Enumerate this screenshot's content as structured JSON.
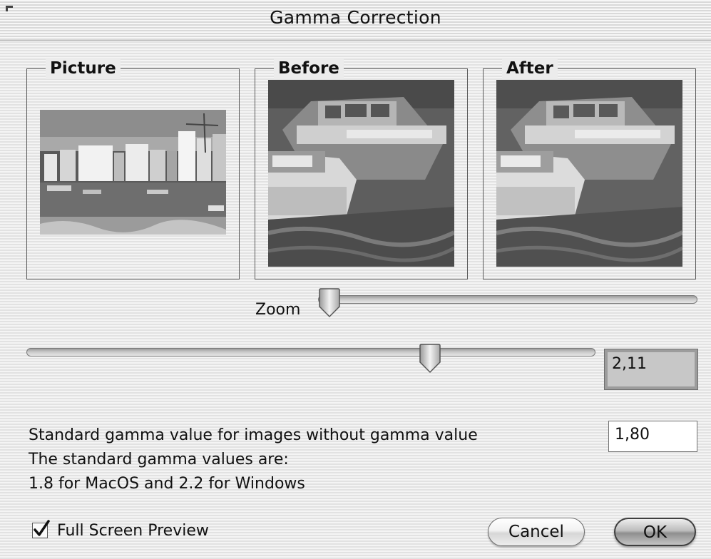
{
  "window": {
    "title": "Gamma Correction"
  },
  "panels": {
    "picture": {
      "label": "Picture"
    },
    "before": {
      "label": "Before"
    },
    "after": {
      "label": "After"
    }
  },
  "zoom": {
    "label": "Zoom",
    "position": 0.0
  },
  "gamma_slider": {
    "position": 0.66,
    "value": "2,11"
  },
  "standard_gamma": {
    "line1": "Standard gamma value for images without gamma value",
    "line2": "The standard gamma values are:",
    "line3": "1.8 for MacOS and 2.2 for Windows",
    "value": "1,80"
  },
  "full_screen_preview": {
    "label": "Full Screen Preview",
    "checked": true
  },
  "buttons": {
    "cancel": "Cancel",
    "ok": "OK"
  }
}
